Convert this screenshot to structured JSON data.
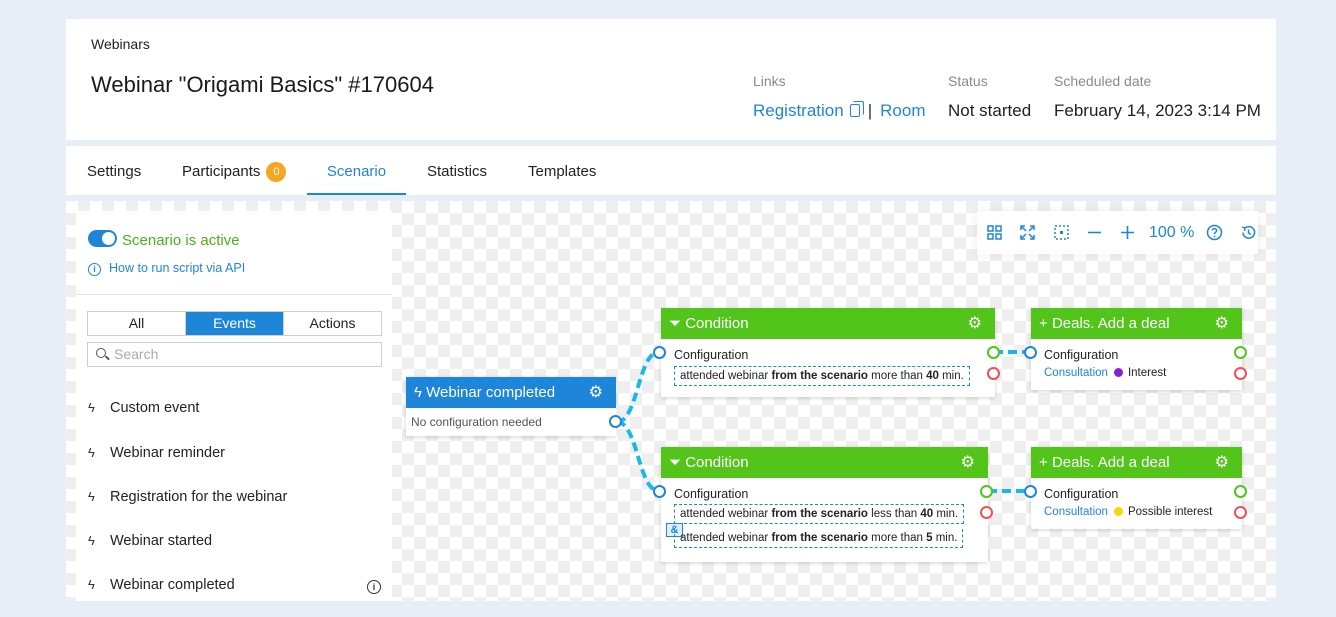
{
  "breadcrumb": "Webinars",
  "page_title": "Webinar \"Origami Basics\" #170604",
  "meta": {
    "links_label": "Links",
    "registration": "Registration",
    "separator": "|",
    "room": "Room",
    "status_label": "Status",
    "status_value": "Not started",
    "date_label": "Scheduled date",
    "date_value": "February 14, 2023 3:14 PM"
  },
  "tabs": {
    "settings": "Settings",
    "participants": "Participants",
    "participants_count": "0",
    "scenario": "Scenario",
    "statistics": "Statistics",
    "templates": "Templates"
  },
  "sidebar": {
    "active_label": "Scenario is active",
    "api_link": "How to run script via API",
    "filter": {
      "all": "All",
      "events": "Events",
      "actions": "Actions"
    },
    "search_placeholder": "Search",
    "events": [
      "Custom event",
      "Webinar reminder",
      "Registration for the webinar",
      "Webinar started",
      "Webinar completed"
    ]
  },
  "toolbar": {
    "zoom": "100 %"
  },
  "nodes": {
    "start": {
      "title": "Webinar completed",
      "body": "No configuration needed"
    },
    "cond1": {
      "title": "Condition",
      "config": "Configuration",
      "rule": {
        "a": "attended webinar ",
        "b": "from the scenario",
        "c": " more than ",
        "d": "40",
        "e": " min."
      }
    },
    "cond2": {
      "title": "Condition",
      "config": "Configuration",
      "rule1": {
        "a": "attended webinar ",
        "b": "from the scenario",
        "c": " less than ",
        "d": "40",
        "e": " min."
      },
      "amp": "&",
      "rule2": {
        "a": "attended webinar ",
        "b": "from the scenario",
        "c": " more than ",
        "d": "5",
        "e": " min."
      }
    },
    "deal1": {
      "title": "Deals. Add a deal",
      "config": "Configuration",
      "pipeline": "Consultation",
      "stage": "Interest",
      "stage_color": "#8b1fd9"
    },
    "deal2": {
      "title": "Deals. Add a deal",
      "config": "Configuration",
      "pipeline": "Consultation",
      "stage": "Possible interest",
      "stage_color": "#f5d800"
    }
  }
}
